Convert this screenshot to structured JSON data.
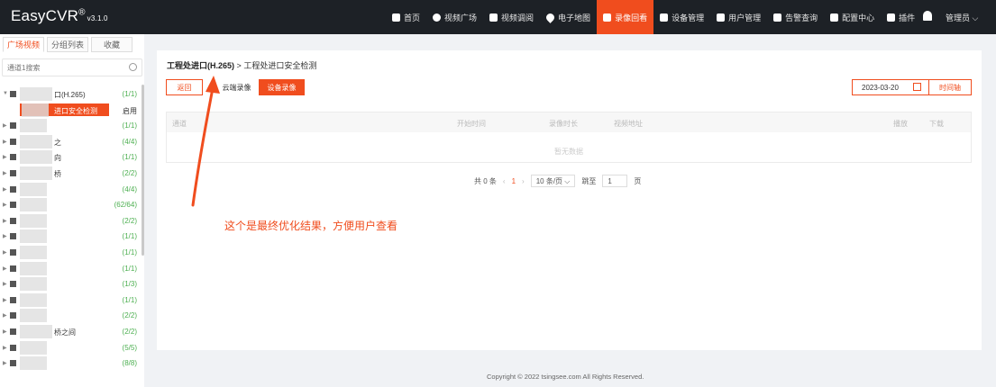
{
  "app": {
    "logo": "EasyCVR",
    "logo_mark": "®",
    "version": "v3.1.0"
  },
  "colors": {
    "accent": "#f04d1e",
    "topbar": "#1d2126",
    "count_green": "#4caf50"
  },
  "nav": {
    "items": [
      {
        "label": "首页",
        "icon": "home-icon"
      },
      {
        "label": "视频广场",
        "icon": "play-icon"
      },
      {
        "label": "视频调阅",
        "icon": "grid-icon"
      },
      {
        "label": "电子地图",
        "icon": "map-pin-icon"
      },
      {
        "label": "录像回看",
        "icon": "video-camera-icon",
        "active": true
      },
      {
        "label": "设备管理",
        "icon": "device-icon"
      },
      {
        "label": "用户管理",
        "icon": "user-icon"
      },
      {
        "label": "告警查询",
        "icon": "alarm-icon"
      },
      {
        "label": "配置中心",
        "icon": "gear-icon"
      },
      {
        "label": "插件",
        "icon": "puzzle-icon"
      }
    ],
    "admin": "管理员 ⌵"
  },
  "sidebar": {
    "tabs": [
      "广场视频",
      "分组列表",
      "收藏"
    ],
    "search_placeholder": "通道1搜索",
    "tree": [
      {
        "name": "口(H.265)",
        "count": "(1/1)",
        "expanded": true
      },
      {
        "name": "进口安全检测",
        "status": "启用",
        "child": true
      },
      {
        "name": "",
        "count": "(1/1)"
      },
      {
        "name": "之",
        "count": "(4/4)"
      },
      {
        "name": "向",
        "count": "(1/1)"
      },
      {
        "name": "桥",
        "count": "(2/2)"
      },
      {
        "name": "",
        "count": "(4/4)"
      },
      {
        "name": "",
        "count": "(62/64)"
      },
      {
        "name": "",
        "count": "(2/2)"
      },
      {
        "name": "",
        "count": "(1/1)"
      },
      {
        "name": "",
        "count": "(1/1)"
      },
      {
        "name": "",
        "count": "(1/1)"
      },
      {
        "name": "",
        "count": "(1/3)"
      },
      {
        "name": "",
        "count": "(1/1)"
      },
      {
        "name": "",
        "count": "(2/2)"
      },
      {
        "name": "桥之间",
        "count": "(2/2)"
      },
      {
        "name": "",
        "count": "(5/5)"
      },
      {
        "name": "",
        "count": "(8/8)"
      }
    ]
  },
  "main": {
    "breadcrumb_bold": "工程处进口(H.265)",
    "breadcrumb_sep": ">",
    "breadcrumb_rest": "工程处进口安全检测",
    "back_label": "返回",
    "cloud_label": "云端录像",
    "device_label": "设备录像",
    "date": "2023-03-20",
    "timeline_label": "时间轴",
    "columns": [
      "通道",
      "开始时间",
      "录像时长",
      "视频地址",
      "播放",
      "下载"
    ],
    "empty_text": "暂无数据",
    "pager": {
      "total": "共 0 条",
      "prev": "‹",
      "page": "1",
      "next": "›",
      "size": "10 条/页 ⌵",
      "jump_label": "跳至",
      "jump_value": "1",
      "page_suffix": "页"
    }
  },
  "annotation": "这个是最终优化结果，方便用户查看",
  "footer": "Copyright © 2022 tsingsee.com All Rights Reserved."
}
